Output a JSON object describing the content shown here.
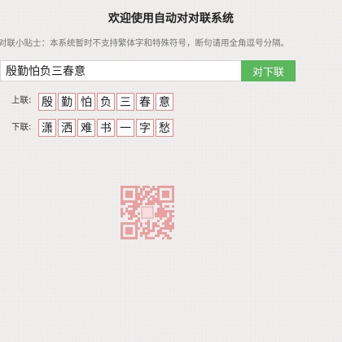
{
  "page": {
    "title": "欢迎使用自动对对联系统",
    "tip": "对联小贴士：本系统暂时不支持繁体字和特殊符号，断句请用全角逗号分隔。"
  },
  "form": {
    "input_value": "殷勤怕负三春意",
    "submit_label": "对下联"
  },
  "result": {
    "upper_label": "上联:",
    "upper_chars": [
      "殷",
      "勤",
      "怕",
      "负",
      "三",
      "春",
      "意"
    ],
    "lower_label": "下联:",
    "lower_chars": [
      "潇",
      "洒",
      "难",
      "书",
      "一",
      "字",
      "愁"
    ]
  },
  "colors": {
    "accent": "#5cb85c",
    "cell_border": "#e88a8a",
    "qr_color": "#e8a0a0",
    "background": "#f0efee"
  }
}
